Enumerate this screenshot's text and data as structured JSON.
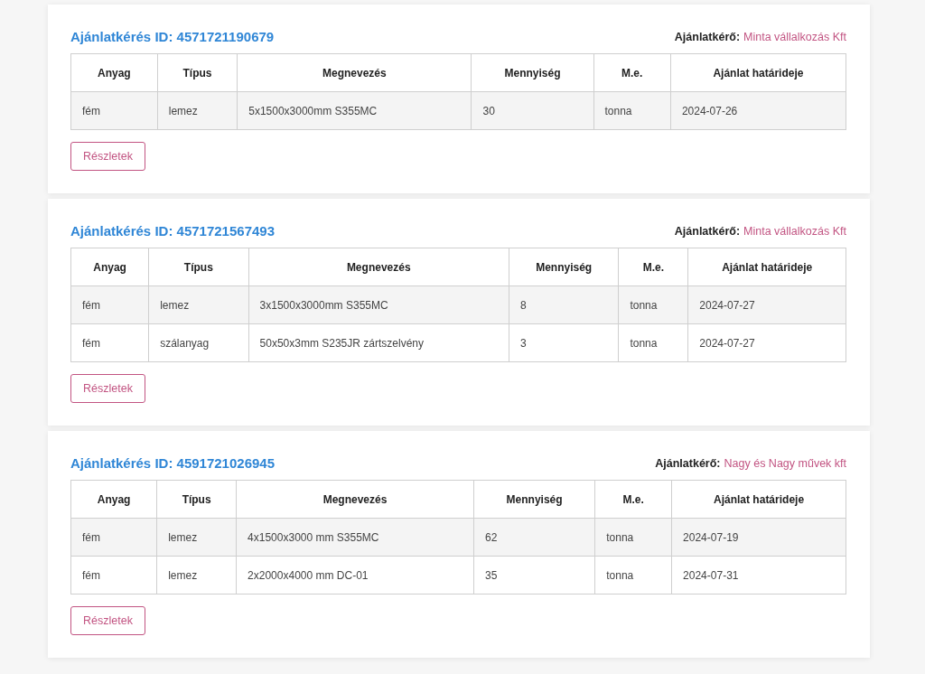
{
  "requests": [
    {
      "title": "Ajánlatkérés ID: 4571721190679",
      "requester_label": "Ajánlatkérő:",
      "requester": "Minta vállalkozás Kft",
      "columns": [
        "Anyag",
        "Típus",
        "Megnevezés",
        "Mennyiség",
        "M.e.",
        "Ajánlat határideje"
      ],
      "rows": [
        [
          "fém",
          "lemez",
          "5x1500x3000mm S355MC",
          "30",
          "tonna",
          "2024-07-26"
        ]
      ],
      "button": "Részletek"
    },
    {
      "title": "Ajánlatkérés ID: 4571721567493",
      "requester_label": "Ajánlatkérő:",
      "requester": "Minta vállalkozás Kft",
      "columns": [
        "Anyag",
        "Típus",
        "Megnevezés",
        "Mennyiség",
        "M.e.",
        "Ajánlat határideje"
      ],
      "rows": [
        [
          "fém",
          "lemez",
          "3x1500x3000mm S355MC",
          "8",
          "tonna",
          "2024-07-27"
        ],
        [
          "fém",
          "szálanyag",
          "50x50x3mm S235JR zártszelvény",
          "3",
          "tonna",
          "2024-07-27"
        ]
      ],
      "button": "Részletek"
    },
    {
      "title": "Ajánlatkérés ID: 4591721026945",
      "requester_label": "Ajánlatkérő:",
      "requester": "Nagy és Nagy művek kft",
      "columns": [
        "Anyag",
        "Típus",
        "Megnevezés",
        "Mennyiség",
        "M.e.",
        "Ajánlat határideje"
      ],
      "rows": [
        [
          "fém",
          "lemez",
          "4x1500x3000 mm S355MC",
          "62",
          "tonna",
          "2024-07-19"
        ],
        [
          "fém",
          "lemez",
          "2x2000x4000 mm DC-01",
          "35",
          "tonna",
          "2024-07-31"
        ]
      ],
      "button": "Részletek"
    }
  ]
}
